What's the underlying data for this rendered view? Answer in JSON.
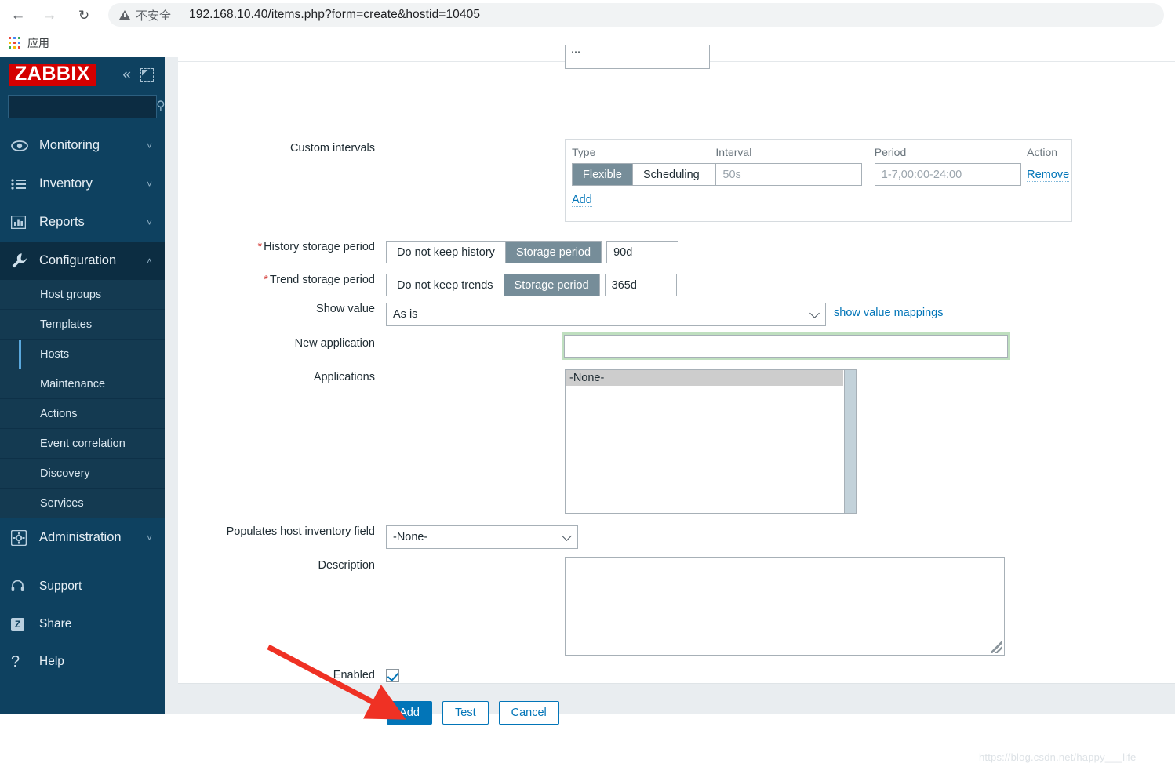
{
  "browser": {
    "back_icon": "back-arrow-icon",
    "forward_icon": "forward-arrow-icon",
    "reload_icon": "reload-icon",
    "security_label": "不安全",
    "url": "192.168.10.40/items.php?form=create&hostid=10405",
    "bookmark_apps_label": "应用"
  },
  "sidebar": {
    "logo": "ZABBIX",
    "collapse_icon": "double-chevron-left-icon",
    "compact_icon": "collapse-compact-icon",
    "search": {
      "value": "",
      "placeholder": ""
    },
    "sections": [
      {
        "label": "Monitoring",
        "icon": "eye-icon",
        "caret": "chevron-down-icon"
      },
      {
        "label": "Inventory",
        "icon": "list-icon",
        "caret": "chevron-down-icon"
      },
      {
        "label": "Reports",
        "icon": "bar-chart-icon",
        "caret": "chevron-down-icon"
      },
      {
        "label": "Configuration",
        "icon": "wrench-icon",
        "caret": "chevron-up-icon"
      }
    ],
    "config_children": [
      "Host groups",
      "Templates",
      "Hosts",
      "Maintenance",
      "Actions",
      "Event correlation",
      "Discovery",
      "Services"
    ],
    "selected_child": "Hosts",
    "administration": {
      "label": "Administration",
      "icon": "gear-icon",
      "caret": "chevron-down-icon"
    },
    "bottom_items": [
      {
        "label": "Support",
        "icon": "headset-icon"
      },
      {
        "label": "Share",
        "icon": "zabbix-z-icon"
      },
      {
        "label": "Help",
        "icon": "question-mark-icon"
      }
    ],
    "colors": {
      "bg": "#0e4160",
      "accent": "#5aa8dd",
      "logo_bg": "#d40000"
    }
  },
  "form": {
    "cut_field_value": "...",
    "custom_intervals": {
      "label": "Custom intervals",
      "headers": [
        "Type",
        "Interval",
        "Period",
        "Action"
      ],
      "rows": [
        {
          "type_options": [
            "Flexible",
            "Scheduling"
          ],
          "type_selected": "Flexible",
          "interval_value": "",
          "interval_placeholder": "50s",
          "period_value": "",
          "period_placeholder": "1-7,00:00-24:00",
          "action_label": "Remove"
        }
      ],
      "add_label": "Add"
    },
    "history_storage": {
      "label": "History storage period",
      "required": "*",
      "options": [
        "Do not keep history",
        "Storage period"
      ],
      "selected": "Storage period",
      "value": "90d"
    },
    "trend_storage": {
      "label": "Trend storage period",
      "required": "*",
      "options": [
        "Do not keep trends",
        "Storage period"
      ],
      "selected": "Storage period",
      "value": "365d"
    },
    "show_value": {
      "label": "Show value",
      "selected": "As is",
      "link_label": "show value mappings"
    },
    "new_application": {
      "label": "New application",
      "value": "",
      "placeholder": ""
    },
    "applications": {
      "label": "Applications",
      "options": [
        "-None-"
      ],
      "selected": "-None-"
    },
    "inventory_field": {
      "label": "Populates host inventory field",
      "selected": "-None-"
    },
    "description": {
      "label": "Description",
      "value": "",
      "placeholder": ""
    },
    "enabled": {
      "label": "Enabled",
      "checked": true
    },
    "buttons": {
      "submit": "Add",
      "test": "Test",
      "cancel": "Cancel"
    }
  },
  "annotation": {
    "arrow": "red-arrow-pointing-to-add-button",
    "color": "#ef3124"
  },
  "watermark": "https://blog.csdn.net/happy___life"
}
